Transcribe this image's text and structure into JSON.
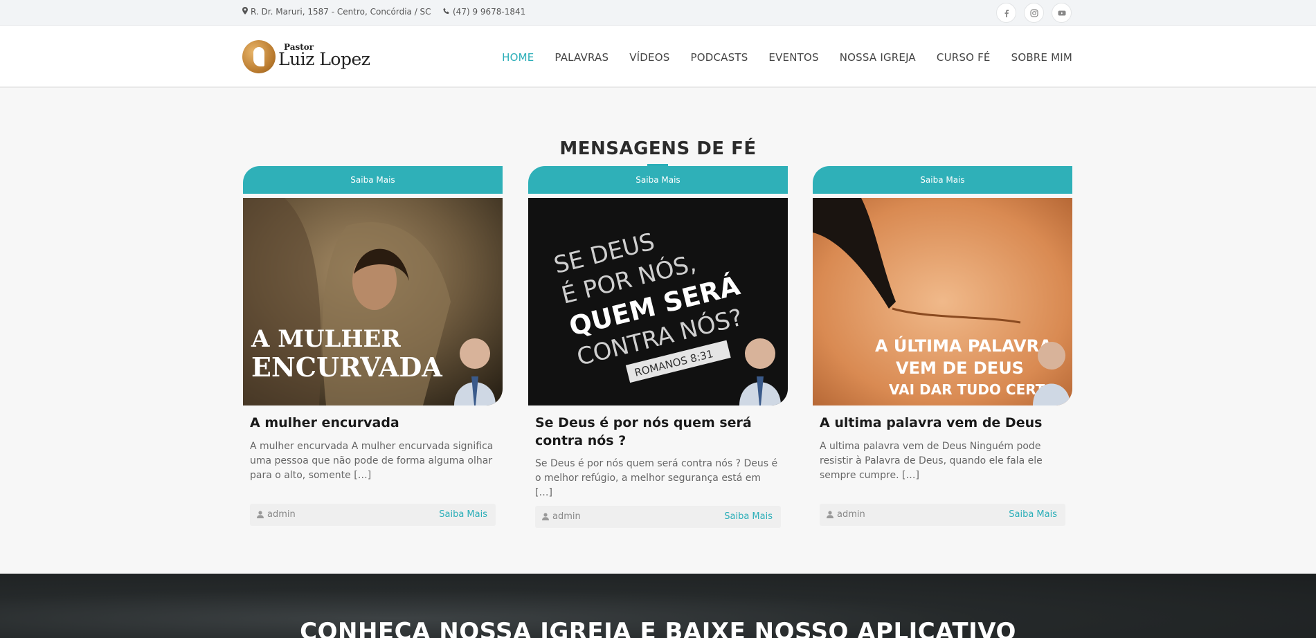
{
  "topbar": {
    "address": "R. Dr. Maruri, 1587 - Centro, Concórdia / SC",
    "phone": "(47) 9 9678-1841",
    "social": [
      "facebook-icon",
      "instagram-icon",
      "youtube-icon"
    ]
  },
  "logo": {
    "small": "Pastor",
    "big": "Luiz Lopez"
  },
  "nav": {
    "items": [
      "HOME",
      "PALAVRAS",
      "VÍDEOS",
      "PODCASTS",
      "EVENTOS",
      "NOSSA IGREJA",
      "CURSO FÉ",
      "SOBRE MIM"
    ],
    "active": "HOME"
  },
  "section": {
    "title": "MENSAGENS DE FÉ"
  },
  "cards": [
    {
      "tab": "Saiba Mais",
      "image_text": [
        "A MULHER",
        "ENCURVADA"
      ],
      "title": "A mulher encurvada",
      "excerpt": "A mulher encurvada A mulher encurvada significa uma pessoa que não pode de forma alguma olhar para o alto, somente […]",
      "author": "admin",
      "more": "Saiba Mais"
    },
    {
      "tab": "Saiba Mais",
      "image_text": [
        "SE DEUS",
        "É POR NÓS,",
        "QUEM SERÁ",
        "CONTRA NÓS?",
        "ROMANOS 8:31"
      ],
      "title": "Se Deus é por nós quem será contra nós ?",
      "excerpt": "Se Deus é por nós quem será contra nós ? Deus é o melhor refúgio, a melhor segurança está em […]",
      "author": "admin",
      "more": "Saiba Mais"
    },
    {
      "tab": "Saiba Mais",
      "image_text": [
        "A ÚLTIMA PALAVRA",
        "VEM DE DEUS",
        "VAI DAR TUDO CERTO"
      ],
      "title": "A ultima palavra vem de Deus",
      "excerpt": "A ultima palavra vem de Deus   Ninguém pode resistir à Palavra de Deus, quando ele fala ele sempre cumpre. […]",
      "author": "admin",
      "more": "Saiba Mais"
    }
  ],
  "band": {
    "heading": "CONHEÇA NOSSA IGREJA E BAIXE NOSSO APLICATIVO"
  },
  "colors": {
    "accent": "#2aaeb8",
    "tab": "#2fb0b8",
    "dark_band": "#25292a"
  }
}
